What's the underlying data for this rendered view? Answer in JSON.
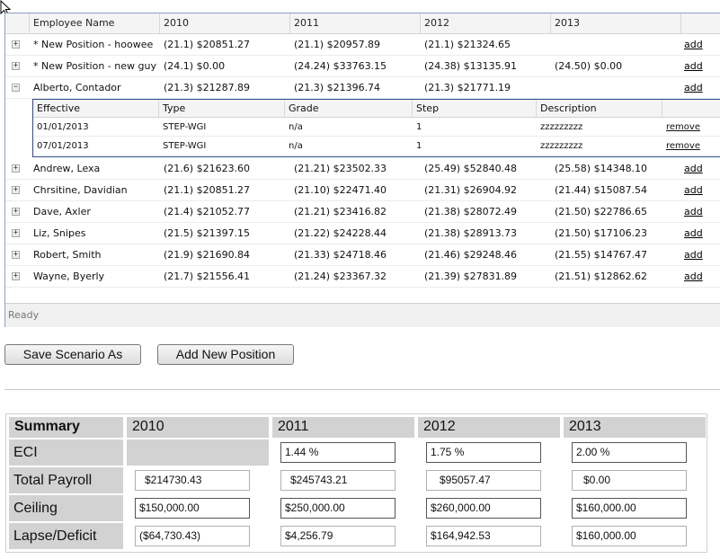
{
  "grid": {
    "columns": [
      "Employee Name",
      "2010",
      "2011",
      "2012",
      "2013"
    ],
    "add_label": "add",
    "rows_top": [
      {
        "expander": "+",
        "name": "* New Position - hoowee",
        "y2010": "(21.1) $20851.27",
        "y2011": "(21.1) $20957.89",
        "y2012": "(21.1) $21324.65",
        "y2013": ""
      },
      {
        "expander": "+",
        "name": "* New Position - new guy",
        "y2010": "(24.1) $0.00",
        "y2011": "(24.24) $33763.15",
        "y2012": "(24.38) $13135.91",
        "y2013": "(24.50) $0.00"
      },
      {
        "expander": "−",
        "name": "Alberto, Contador",
        "y2010": "(21.3) $21287.89",
        "y2011": "(21.3) $21396.74",
        "y2012": "(21.3) $21771.19",
        "y2013": ""
      }
    ],
    "detail": {
      "columns": [
        "Effective",
        "Type",
        "Grade",
        "Step",
        "Description"
      ],
      "remove_label": "remove",
      "rows": [
        {
          "effective": "01/01/2013",
          "type": "STEP-WGI",
          "grade": "n/a",
          "step": "1",
          "description": "zzzzzzzzz"
        },
        {
          "effective": "07/01/2013",
          "type": "STEP-WGI",
          "grade": "n/a",
          "step": "1",
          "description": "zzzzzzzzz"
        }
      ]
    },
    "rows_bottom": [
      {
        "expander": "+",
        "name": "Andrew, Lexa",
        "y2010": "(21.6) $21623.60",
        "y2011": "(21.21) $23502.33",
        "y2012": "(25.49) $52840.48",
        "y2013": "(25.58) $14348.10"
      },
      {
        "expander": "+",
        "name": "Chrsitine, Davidian",
        "y2010": "(21.1) $20851.27",
        "y2011": "(21.10) $22471.40",
        "y2012": "(21.31) $26904.92",
        "y2013": "(21.44) $15087.54"
      },
      {
        "expander": "+",
        "name": "Dave, Axler",
        "y2010": "(21.4) $21052.77",
        "y2011": "(21.21) $23416.82",
        "y2012": "(21.38) $28072.49",
        "y2013": "(21.50) $22786.65"
      },
      {
        "expander": "+",
        "name": "Liz, Snipes",
        "y2010": "(21.5) $21397.15",
        "y2011": "(21.22) $24228.44",
        "y2012": "(21.38) $28913.73",
        "y2013": "(21.50) $17106.23"
      },
      {
        "expander": "+",
        "name": "Robert, Smith",
        "y2010": "(21.9) $21690.84",
        "y2011": "(21.33) $24718.46",
        "y2012": "(21.46) $29248.46",
        "y2013": "(21.55) $14767.47"
      },
      {
        "expander": "+",
        "name": "Wayne, Byerly",
        "y2010": "(21.7) $21556.41",
        "y2011": "(21.24) $23367.32",
        "y2012": "(21.39) $27831.89",
        "y2013": "(21.51) $12862.62"
      }
    ],
    "status": "Ready"
  },
  "buttons": {
    "save_scenario": "Save Scenario As",
    "add_position": "Add New Position"
  },
  "summary": {
    "header": [
      "Summary",
      "2010",
      "2011",
      "2012",
      "2013"
    ],
    "rows": [
      {
        "label": "ECI",
        "values": [
          "",
          "1.44 %",
          "1.75 %",
          "2.00 %"
        ]
      },
      {
        "label": "Total Payroll",
        "values": [
          "$214730.43",
          "$245743.21",
          "$95057.47",
          "$0.00"
        ]
      },
      {
        "label": "Ceiling",
        "values": [
          "$150,000.00",
          "$250,000.00",
          "$260,000.00",
          "$160,000.00"
        ]
      },
      {
        "label": "Lapse/Deficit",
        "values": [
          "($64,730.43)",
          "$4,256.79",
          "$164,942.53",
          "$160,000.00"
        ]
      }
    ]
  },
  "colors": {
    "grid_border": "#8aa0c0",
    "detail_border": "#2f4d86",
    "summary_header_bg": "#d2d2d2"
  }
}
